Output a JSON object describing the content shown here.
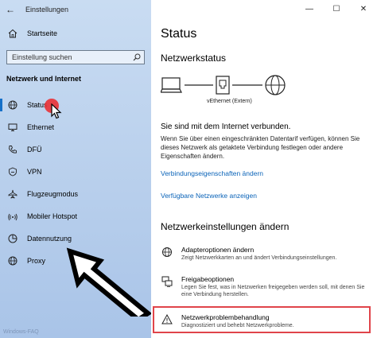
{
  "window": {
    "back_glyph": "←",
    "title": "Einstellungen",
    "min_glyph": "—",
    "max_glyph": "☐",
    "close_glyph": "✕"
  },
  "sidebar": {
    "home_label": "Startseite",
    "search_placeholder": "Einstellung suchen",
    "section_title": "Netzwerk und Internet",
    "items": [
      {
        "label": "Status",
        "icon": "globe-status-icon",
        "active": true
      },
      {
        "label": "Ethernet",
        "icon": "monitor-icon"
      },
      {
        "label": "DFÜ",
        "icon": "phone-icon"
      },
      {
        "label": "VPN",
        "icon": "vpn-icon"
      },
      {
        "label": "Flugzeugmodus",
        "icon": "airplane-icon"
      },
      {
        "label": "Mobiler Hotspot",
        "icon": "hotspot-icon"
      },
      {
        "label": "Datennutzung",
        "icon": "data-usage-icon"
      },
      {
        "label": "Proxy",
        "icon": "globe-icon"
      }
    ],
    "accent": "#1570c8"
  },
  "main": {
    "title": "Status",
    "network_status_heading": "Netzwerkstatus",
    "adapter_label": "vEthernet (Extern)",
    "connected_text": "Sie sind mit dem Internet verbunden.",
    "description": "Wenn Sie über einen eingeschränkten Datentarif verfügen, können Sie dieses Netzwerk als getaktete Verbindung festlegen oder andere Eigenschaften ändern.",
    "link_properties": "Verbindungseigenschaften ändern",
    "link_networks": "Verfügbare Netzwerke anzeigen",
    "settings_heading": "Netzwerkeinstellungen ändern",
    "options": [
      {
        "title": "Adapteroptionen ändern",
        "desc": "Zeigt Netzwerkkarten an und ändert Verbindungseinstellungen.",
        "icon": "adapter-icon"
      },
      {
        "title": "Freigabeoptionen",
        "desc": "Legen Sie fest, was in Netzwerken freigegeben werden soll, mit denen Sie eine Verbindung herstellen.",
        "icon": "sharing-icon"
      },
      {
        "title": "Netzwerkproblembehandlung",
        "desc": "Diagnostiziert und behebt Netzwerkprobleme.",
        "icon": "warning-icon"
      }
    ],
    "link_color": "#0a63b8",
    "highlight_color": "#e0444a"
  },
  "watermark": "Windows-FAQ"
}
